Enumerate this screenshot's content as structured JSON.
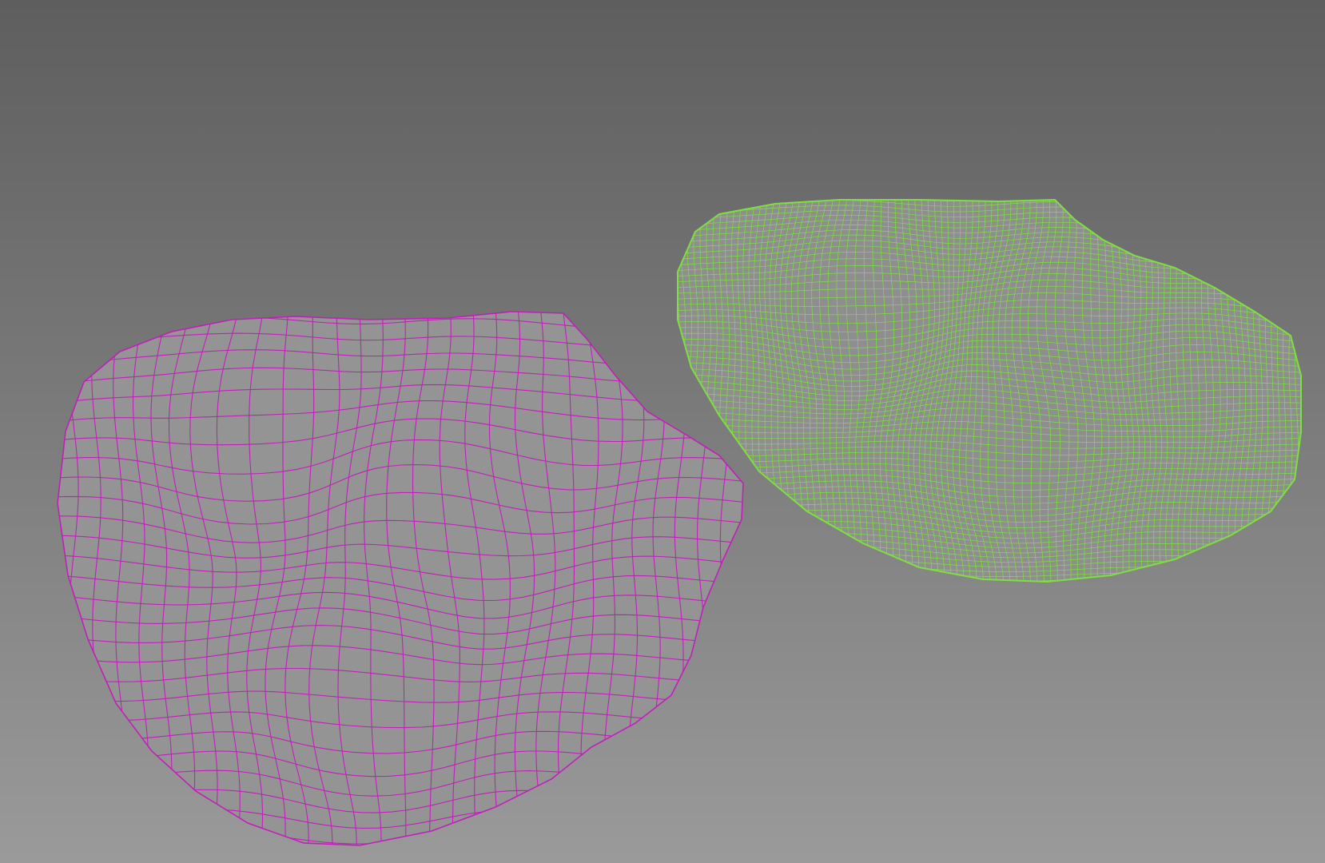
{
  "viewport": {
    "background_top": "#5e5e5e",
    "background_bottom": "#9a9a9a"
  },
  "meshes": [
    {
      "id": "low-res-mesh",
      "wire_color": "#c020b8",
      "density": "low"
    },
    {
      "id": "high-res-mesh",
      "wire_color": "#7ee040",
      "density": "high"
    }
  ]
}
